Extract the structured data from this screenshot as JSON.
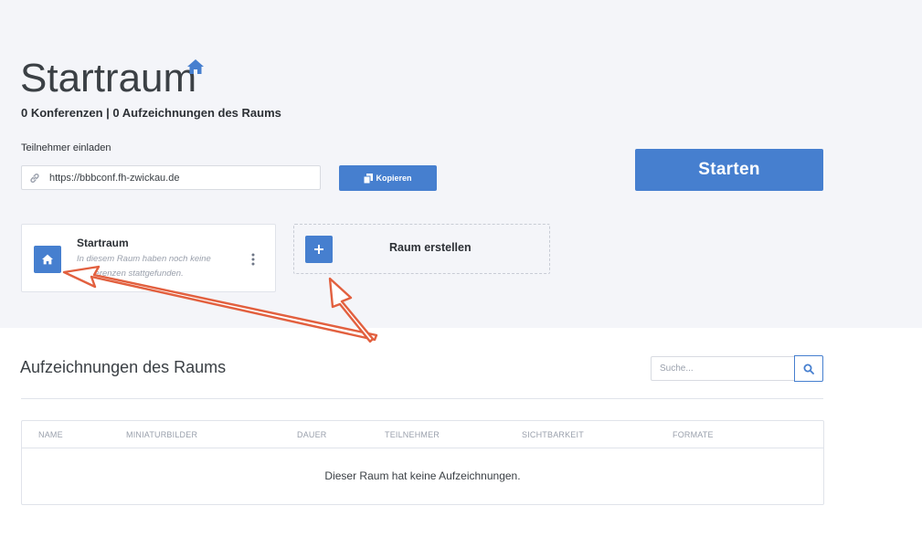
{
  "room": {
    "title": "Startraum",
    "stats": "0 Konferenzen | 0 Aufzeichnungen des Raums"
  },
  "invite": {
    "label": "Teilnehmer einladen",
    "url": "https://bbbconf.fh-zwickau.de",
    "copy_label": "Kopieren"
  },
  "start_label": "Starten",
  "room_card": {
    "name": "Startraum",
    "description": "In diesem Raum haben noch keine Konferenzen stattgefunden."
  },
  "create_room_label": "Raum erstellen",
  "recordings": {
    "title": "Aufzeichnungen des Raums",
    "search_placeholder": "Suche...",
    "columns": [
      "NAME",
      "MINIATURBILDER",
      "DAUER",
      "TEILNEHMER",
      "SICHTBARKEIT",
      "FORMATE"
    ],
    "empty_message": "Dieser Raum hat keine Aufzeichnungen."
  },
  "colors": {
    "primary": "#467fcf",
    "annotation_arrow": "#e2603f",
    "top_background": "#f4f5f9"
  },
  "icons": [
    "home-icon",
    "link-icon",
    "copy-icon",
    "plus-icon",
    "kebab-icon",
    "search-icon"
  ]
}
